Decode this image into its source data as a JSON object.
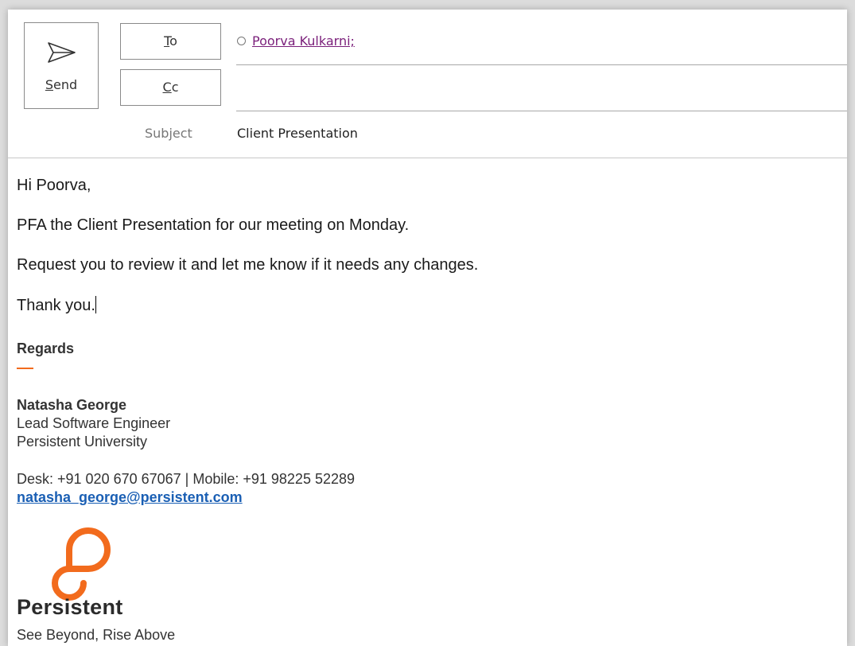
{
  "header": {
    "send_label": "Send",
    "to_label": "To",
    "cc_label": "Cc",
    "subject_label": "Subject",
    "subject_value": "Client Presentation",
    "to_recipients": [
      "Poorva Kulkarni;"
    ],
    "cc_value": ""
  },
  "body": {
    "greeting": "Hi Poorva,",
    "line1": "PFA the Client Presentation for our meeting on Monday.",
    "line2": "Request you to review it and let me know if it needs any changes.",
    "line3": "Thank you."
  },
  "signature": {
    "regards": "Regards",
    "name": "Natasha George",
    "title": "Lead Software Engineer",
    "org": "Persistent University",
    "phones": "Desk: +91 020 670 67067 | Mobile: +91 98225 52289",
    "email": "natasha_george@persistent.com",
    "logo_text": "Persistent",
    "tagline": "See Beyond, Rise Above"
  },
  "colors": {
    "accent": "#f26b1d",
    "link": "#1a5fb4",
    "recipient": "#7a1f7a"
  },
  "icons": {
    "send": "paper-plane-icon",
    "presence": "presence-circle-icon",
    "logo": "persistent-logo-icon"
  }
}
